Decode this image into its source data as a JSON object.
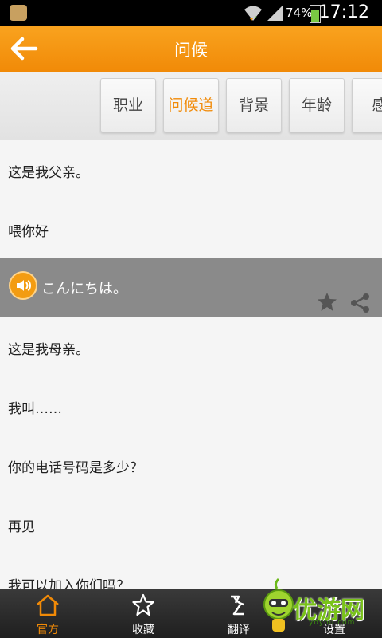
{
  "status_bar": {
    "battery": "74%",
    "battery_level": 0.74,
    "time": "17:12"
  },
  "header": {
    "title": "问候"
  },
  "categories": [
    {
      "label": "职业"
    },
    {
      "label": "问候道"
    },
    {
      "label": "背景"
    },
    {
      "label": "年龄"
    },
    {
      "label": "感"
    }
  ],
  "phrases": [
    {
      "text": "这是我父亲。"
    },
    {
      "text": "喂你好"
    },
    {
      "text": "这是我母亲。"
    },
    {
      "text": "我叫……"
    },
    {
      "text": "你的电话号码是多少？"
    },
    {
      "text": "再见"
    },
    {
      "text": "我可以加入你们吗？"
    }
  ],
  "expanded_phrase": {
    "translation": "こんにちは。"
  },
  "bottom_nav": [
    {
      "label": "官方"
    },
    {
      "label": "收藏"
    },
    {
      "label": "翻译"
    },
    {
      "label": "设置"
    }
  ],
  "watermark": {
    "brand": "优游网",
    "domain": "yoyou.com"
  },
  "colors": {
    "accent": "#f18a07",
    "expanded_row": "#8a8a8a"
  }
}
